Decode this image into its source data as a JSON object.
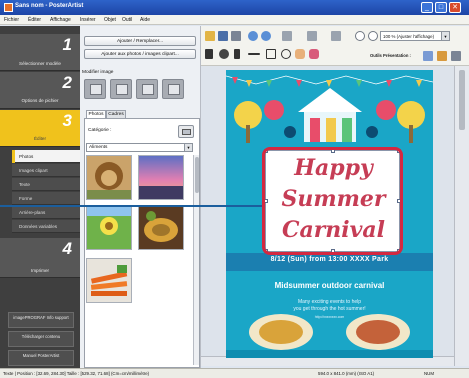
{
  "window": {
    "title": "Sans nom - PosterArtist",
    "buttons": [
      "_",
      "□",
      "✕"
    ]
  },
  "menu": [
    "Fichier",
    "Éditer",
    "Affichage",
    "Insérer",
    "Objet",
    "Outil",
    "Aide"
  ],
  "steps": [
    {
      "num": "1",
      "label": "Sélectionner modèle"
    },
    {
      "num": "2",
      "label": "Options de pichier"
    },
    {
      "num": "3",
      "label": "Éditer"
    },
    {
      "num": "4",
      "label": "Imprimer"
    }
  ],
  "edit_subitems": [
    "Photos",
    "Images clipart",
    "Texte",
    "Forme",
    "Arrière-plans",
    "Données variables"
  ],
  "bottom_links": [
    "imagePROGRAF Info support",
    "Télécharger contenu",
    "Manuel PosterArtist"
  ],
  "mid": {
    "add_button": "Ajouter / Remplacer...",
    "add_more_button": "Ajouter aux photos / images clipart...",
    "modify_label": "Modifier image",
    "tabs": [
      "Photos",
      "Cadres"
    ],
    "category_label": "Catégorie :",
    "category_value": "Aliments"
  },
  "toolbar": {
    "zoom_value": "100 % (Ajuster l'affichage)",
    "tools_label": "Outils Présentation :"
  },
  "poster": {
    "headline_lines": [
      "Happy",
      "Summer",
      "Carnival"
    ],
    "date_line": "8/12 (Sun) from 13:00   XXXX Park",
    "subtitle": "Midsummer outdoor carnival",
    "body_lines": [
      "Many exciting events to help",
      "you get through the hot summer!"
    ],
    "url": "http://xxxxxxxx.com"
  },
  "status": {
    "left": "Texte | Position : [32.69, 284.30] Taille : [529.32, 71.68] (Cm=cm/millimètre)",
    "middle": "594.0 x 841.0 (mm) (ISO A1)",
    "right": "NUM"
  },
  "colors": {
    "accent": "#f0c21c",
    "poster_bg": "#1aa6c7",
    "headline": "#c63d55",
    "callout": "#d42840"
  },
  "icons": [
    "folder-icon",
    "save-icon",
    "print-icon",
    "undo-icon",
    "redo-icon",
    "zoom-in-icon",
    "zoom-out-icon",
    "pointer-icon",
    "rotate-icon",
    "text-icon",
    "line-icon",
    "rect-icon",
    "ellipse-icon",
    "hand-icon"
  ]
}
